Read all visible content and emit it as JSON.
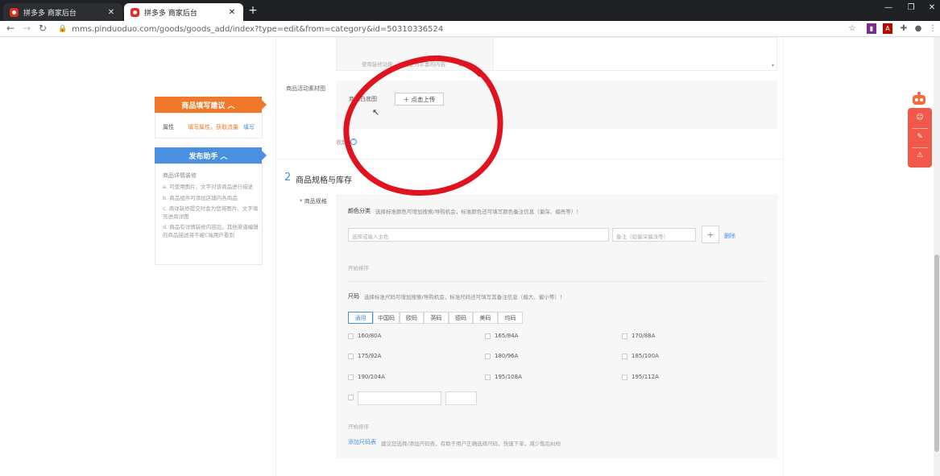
{
  "browser": {
    "tabs": [
      {
        "label": "拼多多 商家后台",
        "active": false
      },
      {
        "label": "拼多多 商家后台",
        "active": true
      }
    ],
    "new_tab": "+",
    "url": "mms.pinduoduo.com/goods/goods_add/index?type=edit&from=category&id=50310336524",
    "win_min": "—",
    "win_restore": "❐",
    "win_close": "✕"
  },
  "sidebar": {
    "suggest": {
      "title": "商品填写建议 ︿",
      "row_label": "属性",
      "row_hint": "填写属性，获取流量",
      "row_action": "填写"
    },
    "assistant": {
      "title": "发布助手 ︿",
      "heading": "商品详情装修",
      "items": [
        "a. 可使用图片、文字对该商品进行描述",
        "b. 商品组件可添加店铺内各商品",
        "c. 商详装修提交时会为您将图片、文字填充进商详图",
        "d. 商品有详情装修内容后，其他渠道编辑的商品描述将不被C端用户看到"
      ]
    }
  },
  "material": {
    "top_hint": "使用装修功能，增加更为丰富的内容",
    "label": "商品活动素材图",
    "white_bg_label": "商品白底图",
    "upload_btn": "＋ 点击上传",
    "collapse": "收起"
  },
  "section": {
    "number": "2",
    "title": "商品规格与库存"
  },
  "spec": {
    "label": "* 商品规格",
    "color": {
      "title": "颜色分类",
      "hint": "选择标准颜色可增加搜索/导购机会，标准颜色还可填写颜色备注信息（偏深、偏亮等）！",
      "input_placeholder": "选择或输入主色",
      "remark_placeholder": "备注（如偏深偏浅等）",
      "add_btn": "+",
      "delete": "删除",
      "sort": "开始排序"
    },
    "size": {
      "title": "尺码",
      "hint": "选择标准尺码可增加搜索/导购机会，标准尺码还可填写其备注信息（偏大、偏小等）！",
      "tabs": [
        "通用",
        "中国码",
        "欧码",
        "英码",
        "德码",
        "美码",
        "均码"
      ],
      "options": [
        "160/80A",
        "165/84A",
        "170/88A",
        "175/92A",
        "180/96A",
        "185/100A",
        "190/104A",
        "195/108A",
        "195/112A"
      ],
      "sort": "开始排序",
      "size_table_link": "添加尺码表",
      "size_table_hint": "建议您选择/添加尺码表，有助于用户正确选择尺码，快速下单，减少售后纠纷"
    }
  },
  "colors": {
    "accent_blue": "#4a90e2",
    "orange": "#f0782a",
    "annotation_red": "#e0141e",
    "float_red": "#f2584a"
  }
}
